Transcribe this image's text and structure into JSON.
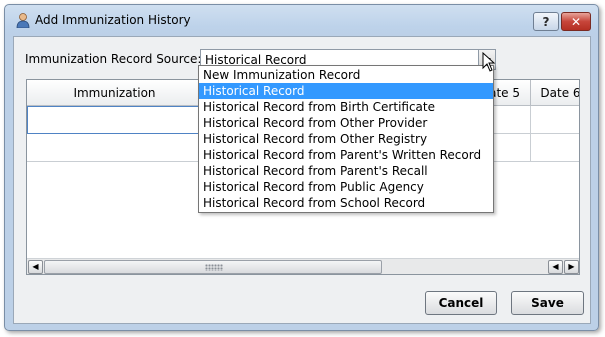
{
  "window": {
    "title": "Add Immunization History"
  },
  "titlebar": {
    "help_label": "?",
    "close_label": "✕"
  },
  "form": {
    "source_label": "Immunization Record Source:",
    "source_value": "Historical Record"
  },
  "grid": {
    "headers": [
      "Immunization",
      "ate 5",
      "Date 6"
    ]
  },
  "dropdown": {
    "options": [
      "New Immunization Record",
      "Historical Record",
      "Historical Record from Birth Certificate",
      "Historical Record from Other Provider",
      "Historical Record from Other Registry",
      "Historical Record from Parent's Written Record",
      "Historical Record from Parent's Recall",
      "Historical Record from Public Agency",
      "Historical Record from School Record"
    ],
    "highlighted_index": 1
  },
  "buttons": {
    "cancel": "Cancel",
    "save": "Save"
  },
  "scrollbar": {
    "left_arrow": "◀",
    "right_arrow": "▶"
  },
  "colors": {
    "highlight": "#3399ff",
    "title_bg": "#bdd2ea",
    "close_red": "#c7453a"
  }
}
